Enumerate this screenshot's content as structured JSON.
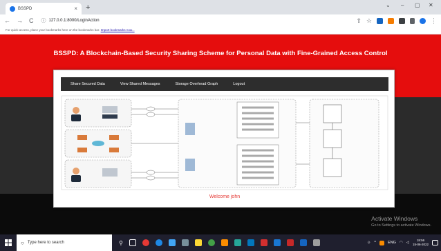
{
  "browser": {
    "tab_title": "BSSPD",
    "tab_close": "×",
    "new_tab": "+",
    "url": "127.0.0.1:8000/LoginAction",
    "window_controls": {
      "chevron": "⌄",
      "minimize": "–",
      "maximize": "▢",
      "close": "✕"
    },
    "bookmarks_text": "For quick access, place your bookmarks here on the bookmarks bar.",
    "bookmarks_link": "Import bookmarks now..."
  },
  "page": {
    "title": "BSSPD: A Blockchain-Based Security Sharing Scheme for Personal Data with Fine-Grained Access Control",
    "menu": [
      "Share Secured Data",
      "View Shared Messages",
      "Storage Overhead Graph",
      "Logout"
    ],
    "welcome": "Welcome john"
  },
  "os": {
    "watermark_title": "Activate Windows",
    "watermark_subtitle": "Go to Settings to activate Windows.",
    "search_placeholder": "Type here to search",
    "time": "18:56",
    "date": "15-06-2022",
    "lang": "ENG"
  },
  "colors": {
    "banner": "#e50d0d",
    "menu_bg": "#2d2d2d",
    "welcome": "#e53935"
  }
}
